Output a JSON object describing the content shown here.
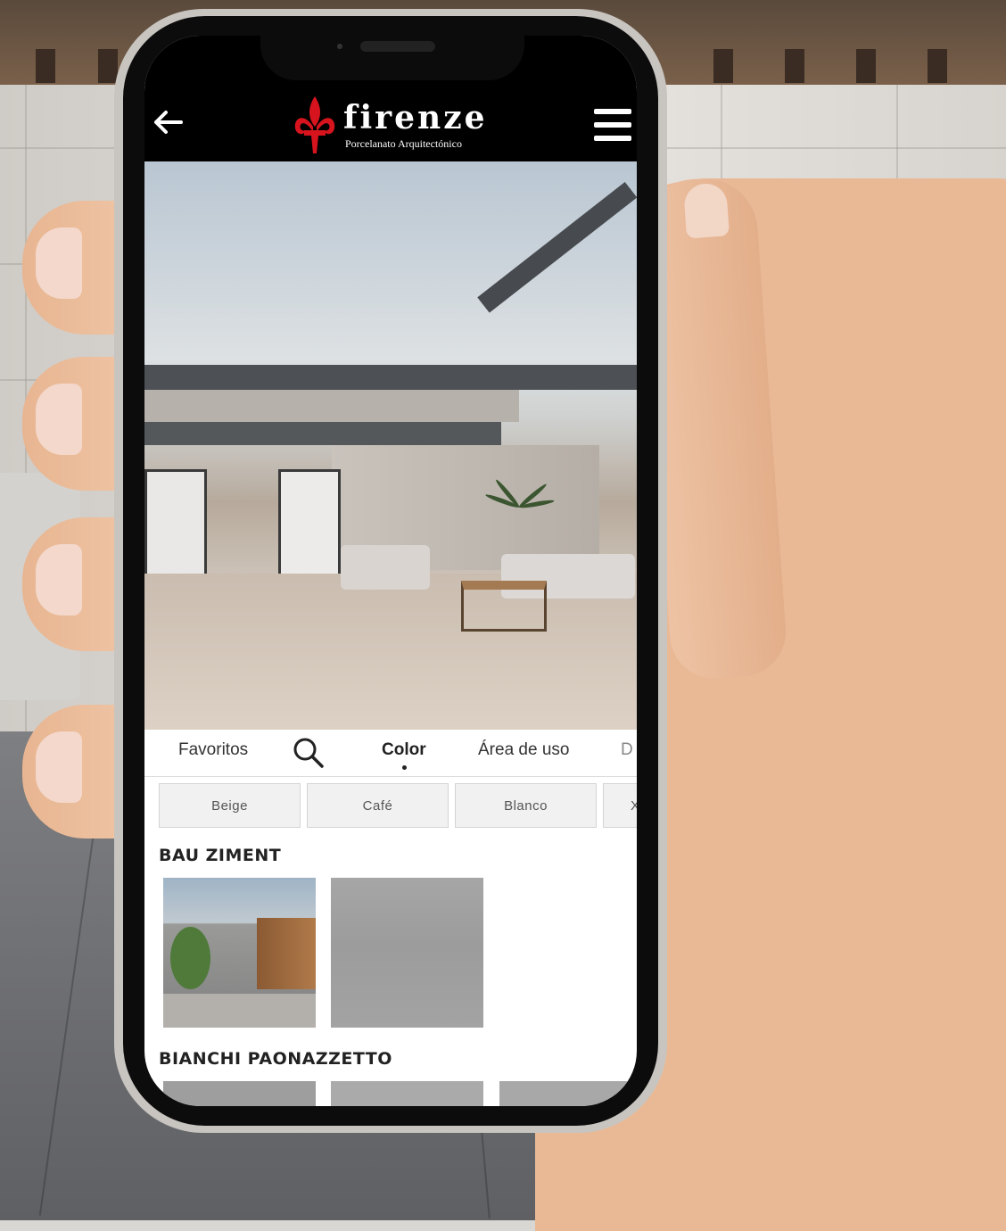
{
  "app": {
    "brand": "firenze",
    "tagline": "Porcelanato Arquitectónico",
    "brand_color": "#d7141e"
  },
  "header": {
    "back_icon": "arrow-left-icon",
    "menu_icon": "hamburger-menu-icon"
  },
  "tabs": [
    {
      "label": "Favoritos",
      "active": false
    },
    {
      "label": "",
      "icon": "search-icon",
      "active": false
    },
    {
      "label": "Color",
      "active": true
    },
    {
      "label": "Área de uso",
      "active": false
    },
    {
      "label": "D",
      "active": false
    }
  ],
  "filters": {
    "chips": [
      "Beige",
      "Café",
      "Blanco",
      "X"
    ]
  },
  "collections": [
    {
      "title": "BAU ZIMENT"
    },
    {
      "title": "BIANCHI PAONAZZETTO"
    }
  ]
}
